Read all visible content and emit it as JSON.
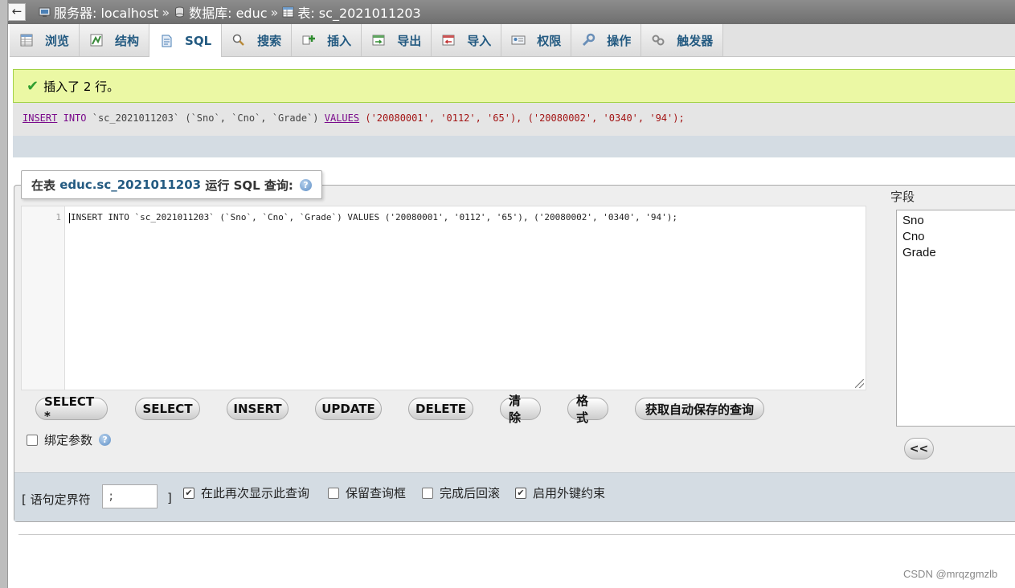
{
  "breadcrumb": {
    "server_label": "服务器: localhost",
    "db_label": "数据库: educ",
    "table_label": "表: sc_2021011203",
    "separator": "»"
  },
  "back_glyph": "←",
  "tabs": [
    {
      "label": "浏览",
      "icon": "browse-icon"
    },
    {
      "label": "结构",
      "icon": "structure-icon"
    },
    {
      "label": "SQL",
      "icon": "sql-icon",
      "active": true
    },
    {
      "label": "搜索",
      "icon": "search-icon"
    },
    {
      "label": "插入",
      "icon": "insert-icon"
    },
    {
      "label": "导出",
      "icon": "export-icon"
    },
    {
      "label": "导入",
      "icon": "import-icon"
    },
    {
      "label": "权限",
      "icon": "privileges-icon"
    },
    {
      "label": "操作",
      "icon": "operations-icon"
    },
    {
      "label": "触发器",
      "icon": "triggers-icon"
    }
  ],
  "result": {
    "message": "插入了 2 行。",
    "check_glyph": "✔",
    "sql_parts": {
      "k1": "INSERT",
      "k2": "INTO",
      "table": "`sc_2021011203`",
      "cols": "(`Sno`, `Cno`, `Grade`)",
      "k3": "VALUES",
      "vals": "('20080001', '0112', '65'), ('20080002', '0340', '94');"
    }
  },
  "query_box": {
    "legend_prefix": "在表",
    "legend_table": "educ.sc_2021011203",
    "legend_suffix": "运行 SQL 查询:",
    "help_glyph": "?",
    "line_number": "1",
    "code": "INSERT INTO `sc_2021011203` (`Sno`, `Cno`, `Grade`) VALUES ('20080001', '0112', '65'), ('20080002', '0340', '94');"
  },
  "buttons": [
    "SELECT *",
    "SELECT",
    "INSERT",
    "UPDATE",
    "DELETE",
    "清除",
    "格式",
    "获取自动保存的查询"
  ],
  "bind_params": {
    "label": "绑定参数",
    "checked": false
  },
  "fields": {
    "label": "字段",
    "items": [
      "Sno",
      "Cno",
      "Grade"
    ],
    "insert_button": "<<"
  },
  "options": {
    "delimiter_open": "[ 语句定界符",
    "delimiter_value": ";",
    "delimiter_close": "]",
    "show_again": {
      "label": "在此再次显示此查询",
      "checked": true
    },
    "retain_box": {
      "label": "保留查询框",
      "checked": false
    },
    "rollback": {
      "label": "完成后回滚",
      "checked": false
    },
    "foreign_keys": {
      "label": "启用外键约束",
      "checked": true
    }
  },
  "watermark": "CSDN @mrqzgmzlb"
}
